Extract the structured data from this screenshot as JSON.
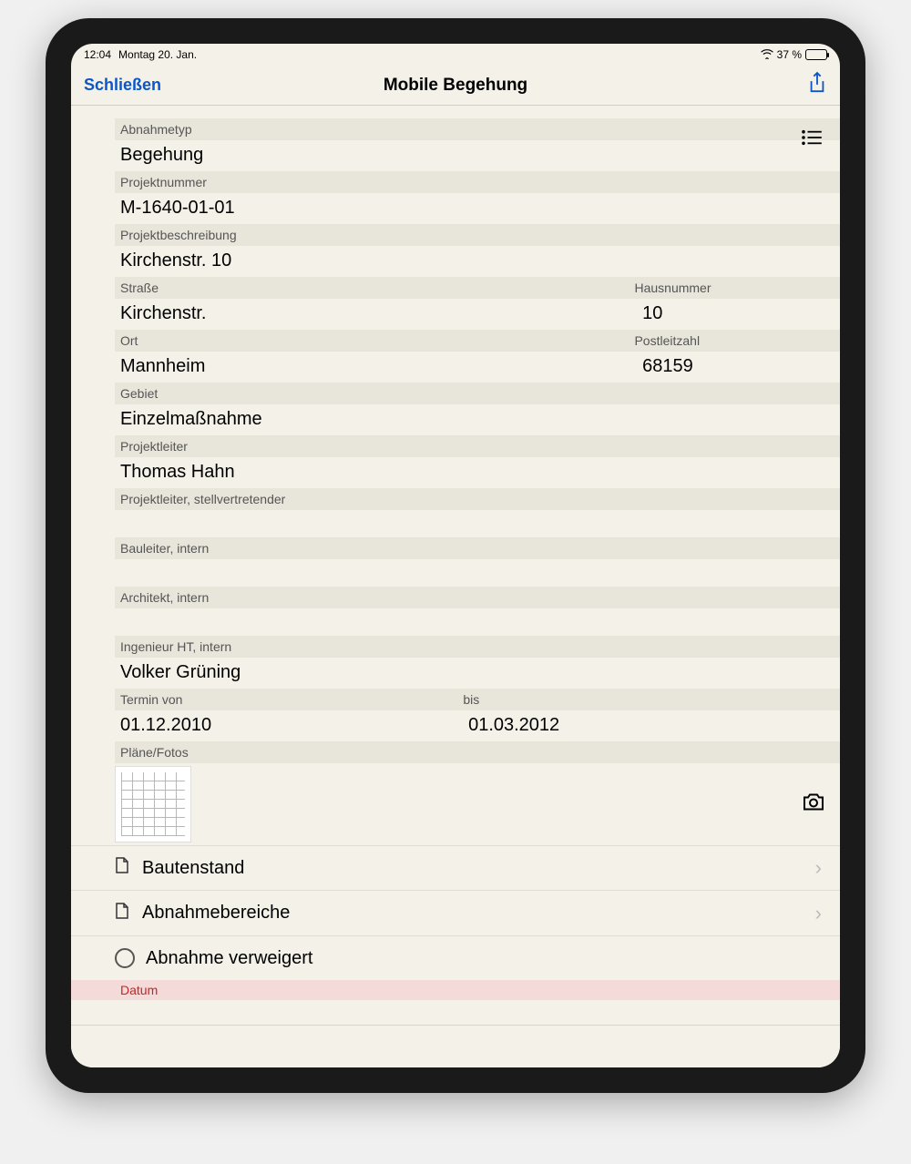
{
  "status": {
    "time": "12:04",
    "date": "Montag 20. Jan.",
    "battery_pct": "37 %"
  },
  "nav": {
    "close": "Schließen",
    "title": "Mobile Begehung"
  },
  "fields": {
    "abnahmetyp_label": "Abnahmetyp",
    "abnahmetyp_value": "Begehung",
    "projektnummer_label": "Projektnummer",
    "projektnummer_value": "M-1640-01-01",
    "projektbeschreibung_label": "Projektbeschreibung",
    "projektbeschreibung_value": "Kirchenstr. 10",
    "strasse_label": "Straße",
    "strasse_value": "Kirchenstr.",
    "hausnummer_label": "Hausnummer",
    "hausnummer_value": "10",
    "ort_label": "Ort",
    "ort_value": "Mannheim",
    "plz_label": "Postleitzahl",
    "plz_value": "68159",
    "gebiet_label": "Gebiet",
    "gebiet_value": "Einzelmaßnahme",
    "projektleiter_label": "Projektleiter",
    "projektleiter_value": "Thomas Hahn",
    "projektleiter_stv_label": "Projektleiter, stellvertretender",
    "projektleiter_stv_value": "",
    "bauleiter_label": "Bauleiter, intern",
    "bauleiter_value": "",
    "architekt_label": "Architekt, intern",
    "architekt_value": "",
    "ingenieur_label": "Ingenieur HT, intern",
    "ingenieur_value": "Volker Grüning",
    "termin_von_label": "Termin von",
    "termin_von_value": "01.12.2010",
    "termin_bis_label": "bis",
    "termin_bis_value": "01.03.2012",
    "plaene_label": "Pläne/Fotos"
  },
  "navitems": {
    "bautenstand": "Bautenstand",
    "abnahmebereiche": "Abnahmebereiche"
  },
  "radio": {
    "abnahme_verweigert": "Abnahme verweigert"
  },
  "datum": {
    "label": "Datum",
    "value": ""
  }
}
